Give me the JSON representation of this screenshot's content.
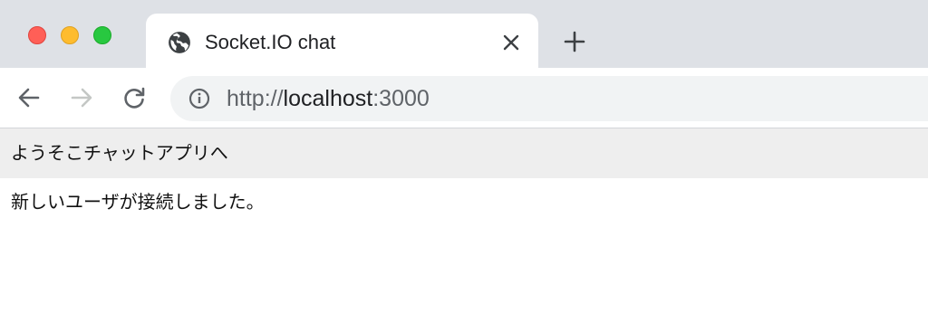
{
  "browser": {
    "tab": {
      "title": "Socket.IO chat",
      "icon": "globe-icon"
    },
    "toolbar": {
      "url_scheme": "http://",
      "url_host": "localhost",
      "url_port": ":3000"
    },
    "colors": {
      "tabstrip": "#dee1e6",
      "close": "#ff5f57",
      "minimize": "#febc2e",
      "zoom": "#28c840"
    }
  },
  "page": {
    "header": "ようそこチャットアプリへ",
    "messages": [
      "新しいユーザが接続しました。"
    ]
  }
}
